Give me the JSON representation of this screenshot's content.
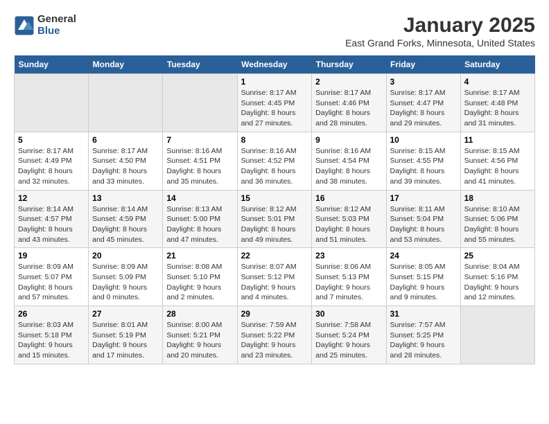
{
  "header": {
    "logo_general": "General",
    "logo_blue": "Blue",
    "title": "January 2025",
    "subtitle": "East Grand Forks, Minnesota, United States"
  },
  "calendar": {
    "days_of_week": [
      "Sunday",
      "Monday",
      "Tuesday",
      "Wednesday",
      "Thursday",
      "Friday",
      "Saturday"
    ],
    "weeks": [
      [
        {
          "num": "",
          "info": ""
        },
        {
          "num": "",
          "info": ""
        },
        {
          "num": "",
          "info": ""
        },
        {
          "num": "1",
          "info": "Sunrise: 8:17 AM\nSunset: 4:45 PM\nDaylight: 8 hours and 27 minutes."
        },
        {
          "num": "2",
          "info": "Sunrise: 8:17 AM\nSunset: 4:46 PM\nDaylight: 8 hours and 28 minutes."
        },
        {
          "num": "3",
          "info": "Sunrise: 8:17 AM\nSunset: 4:47 PM\nDaylight: 8 hours and 29 minutes."
        },
        {
          "num": "4",
          "info": "Sunrise: 8:17 AM\nSunset: 4:48 PM\nDaylight: 8 hours and 31 minutes."
        }
      ],
      [
        {
          "num": "5",
          "info": "Sunrise: 8:17 AM\nSunset: 4:49 PM\nDaylight: 8 hours and 32 minutes."
        },
        {
          "num": "6",
          "info": "Sunrise: 8:17 AM\nSunset: 4:50 PM\nDaylight: 8 hours and 33 minutes."
        },
        {
          "num": "7",
          "info": "Sunrise: 8:16 AM\nSunset: 4:51 PM\nDaylight: 8 hours and 35 minutes."
        },
        {
          "num": "8",
          "info": "Sunrise: 8:16 AM\nSunset: 4:52 PM\nDaylight: 8 hours and 36 minutes."
        },
        {
          "num": "9",
          "info": "Sunrise: 8:16 AM\nSunset: 4:54 PM\nDaylight: 8 hours and 38 minutes."
        },
        {
          "num": "10",
          "info": "Sunrise: 8:15 AM\nSunset: 4:55 PM\nDaylight: 8 hours and 39 minutes."
        },
        {
          "num": "11",
          "info": "Sunrise: 8:15 AM\nSunset: 4:56 PM\nDaylight: 8 hours and 41 minutes."
        }
      ],
      [
        {
          "num": "12",
          "info": "Sunrise: 8:14 AM\nSunset: 4:57 PM\nDaylight: 8 hours and 43 minutes."
        },
        {
          "num": "13",
          "info": "Sunrise: 8:14 AM\nSunset: 4:59 PM\nDaylight: 8 hours and 45 minutes."
        },
        {
          "num": "14",
          "info": "Sunrise: 8:13 AM\nSunset: 5:00 PM\nDaylight: 8 hours and 47 minutes."
        },
        {
          "num": "15",
          "info": "Sunrise: 8:12 AM\nSunset: 5:01 PM\nDaylight: 8 hours and 49 minutes."
        },
        {
          "num": "16",
          "info": "Sunrise: 8:12 AM\nSunset: 5:03 PM\nDaylight: 8 hours and 51 minutes."
        },
        {
          "num": "17",
          "info": "Sunrise: 8:11 AM\nSunset: 5:04 PM\nDaylight: 8 hours and 53 minutes."
        },
        {
          "num": "18",
          "info": "Sunrise: 8:10 AM\nSunset: 5:06 PM\nDaylight: 8 hours and 55 minutes."
        }
      ],
      [
        {
          "num": "19",
          "info": "Sunrise: 8:09 AM\nSunset: 5:07 PM\nDaylight: 8 hours and 57 minutes."
        },
        {
          "num": "20",
          "info": "Sunrise: 8:09 AM\nSunset: 5:09 PM\nDaylight: 9 hours and 0 minutes."
        },
        {
          "num": "21",
          "info": "Sunrise: 8:08 AM\nSunset: 5:10 PM\nDaylight: 9 hours and 2 minutes."
        },
        {
          "num": "22",
          "info": "Sunrise: 8:07 AM\nSunset: 5:12 PM\nDaylight: 9 hours and 4 minutes."
        },
        {
          "num": "23",
          "info": "Sunrise: 8:06 AM\nSunset: 5:13 PM\nDaylight: 9 hours and 7 minutes."
        },
        {
          "num": "24",
          "info": "Sunrise: 8:05 AM\nSunset: 5:15 PM\nDaylight: 9 hours and 9 minutes."
        },
        {
          "num": "25",
          "info": "Sunrise: 8:04 AM\nSunset: 5:16 PM\nDaylight: 9 hours and 12 minutes."
        }
      ],
      [
        {
          "num": "26",
          "info": "Sunrise: 8:03 AM\nSunset: 5:18 PM\nDaylight: 9 hours and 15 minutes."
        },
        {
          "num": "27",
          "info": "Sunrise: 8:01 AM\nSunset: 5:19 PM\nDaylight: 9 hours and 17 minutes."
        },
        {
          "num": "28",
          "info": "Sunrise: 8:00 AM\nSunset: 5:21 PM\nDaylight: 9 hours and 20 minutes."
        },
        {
          "num": "29",
          "info": "Sunrise: 7:59 AM\nSunset: 5:22 PM\nDaylight: 9 hours and 23 minutes."
        },
        {
          "num": "30",
          "info": "Sunrise: 7:58 AM\nSunset: 5:24 PM\nDaylight: 9 hours and 25 minutes."
        },
        {
          "num": "31",
          "info": "Sunrise: 7:57 AM\nSunset: 5:25 PM\nDaylight: 9 hours and 28 minutes."
        },
        {
          "num": "",
          "info": ""
        }
      ]
    ]
  }
}
